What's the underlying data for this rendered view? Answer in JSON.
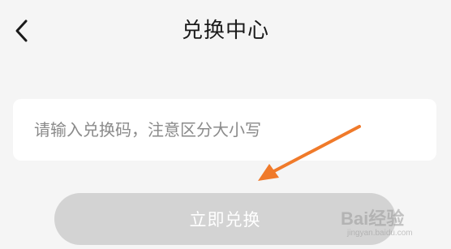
{
  "header": {
    "back_icon": "chevron-left-icon",
    "title": "兑换中心"
  },
  "redeem": {
    "placeholder": "请输入兑换码，注意区分大小写",
    "button_label": "立即兑换"
  },
  "annotation": {
    "arrow_color": "#f07a2a"
  },
  "watermark": {
    "main": "Bai经验",
    "sub": "jingyan.baidu.com"
  },
  "colors": {
    "background": "#f5f5f5",
    "card": "#ffffff",
    "button_disabled": "#d3d3d3",
    "text_primary": "#1a1a1a",
    "placeholder": "#8a8a8a"
  }
}
